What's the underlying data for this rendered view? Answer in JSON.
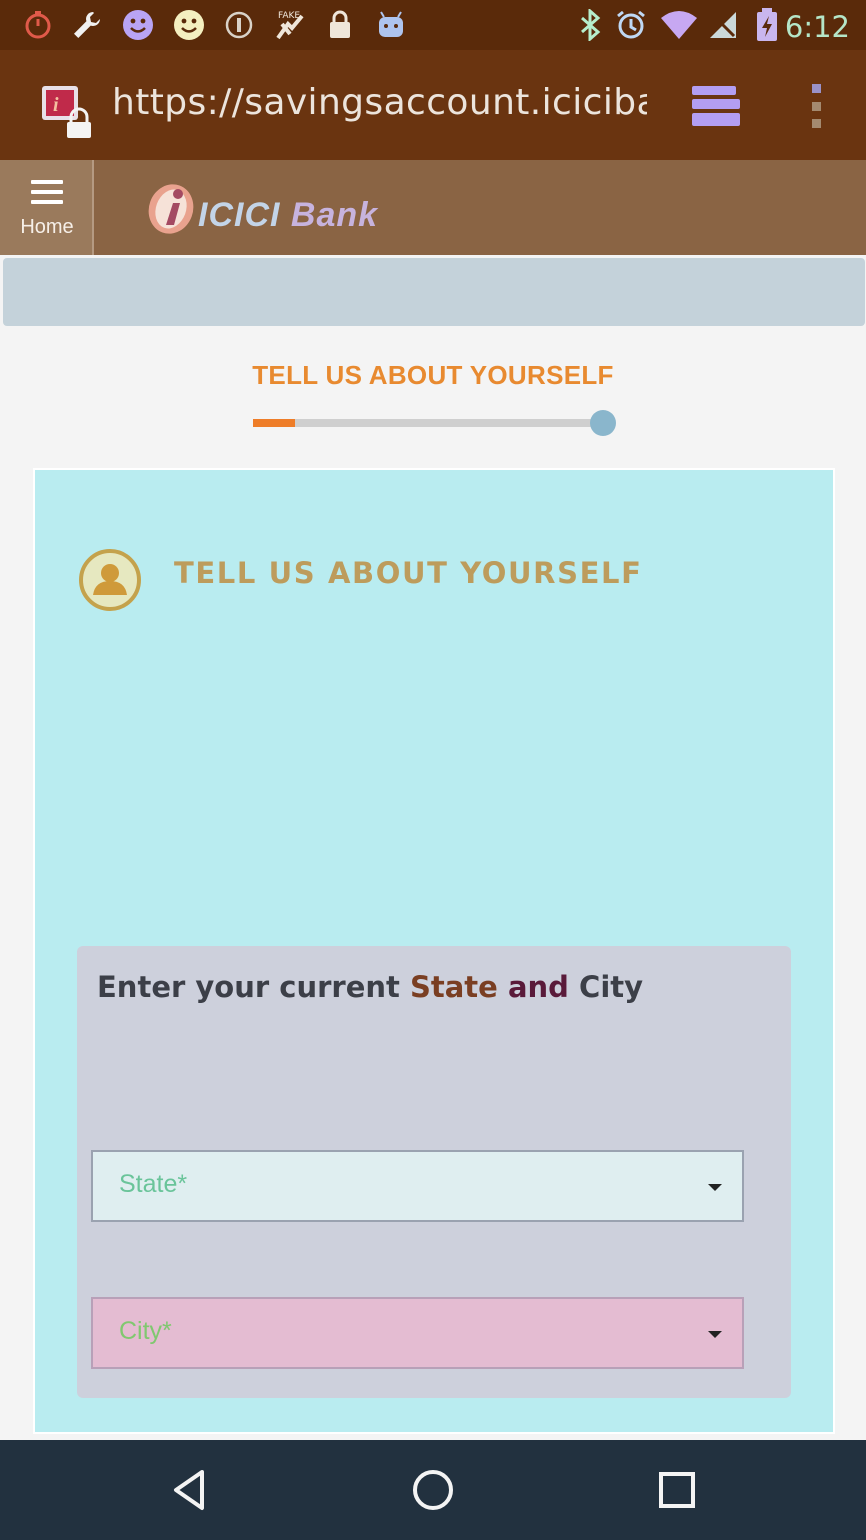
{
  "status_bar": {
    "time": "6:12",
    "icons": [
      "timer-icon",
      "wrench-icon",
      "smiley-purple-icon",
      "smiley-yellow-icon",
      "info-circle-icon",
      "fake-gps-icon",
      "lock-icon",
      "android-icon",
      "bluetooth-icon",
      "alarm-icon",
      "wifi-icon",
      "signal-off-icon",
      "battery-charging-icon"
    ],
    "colors": {
      "background": "#5a2a0a",
      "time": "#b5e6c8"
    }
  },
  "browser": {
    "url": "https://savingsaccount.icicibank",
    "tabs_icon": "tabs-stack-icon",
    "menu_icon": "overflow-menu-icon"
  },
  "site_header": {
    "home_label": "Home",
    "brand_name": "ICICI",
    "brand_suffix": "Bank"
  },
  "progress": {
    "title": "TELL US ABOUT YOURSELF",
    "fraction": 0.12,
    "accent_color": "#ee7d28"
  },
  "card": {
    "title": "TELL US ABOUT YOURSELF",
    "avatar_icon": "user-avatar-icon",
    "panel": {
      "heading_prefix": "Enter your current ",
      "heading_state": "State",
      "heading_and": "and",
      "heading_city": "City",
      "state_placeholder": "State*",
      "city_placeholder": "City*"
    }
  },
  "nav_bar": {
    "back_icon": "back-triangle-icon",
    "home_icon": "home-circle-icon",
    "recents_icon": "recents-square-icon"
  }
}
